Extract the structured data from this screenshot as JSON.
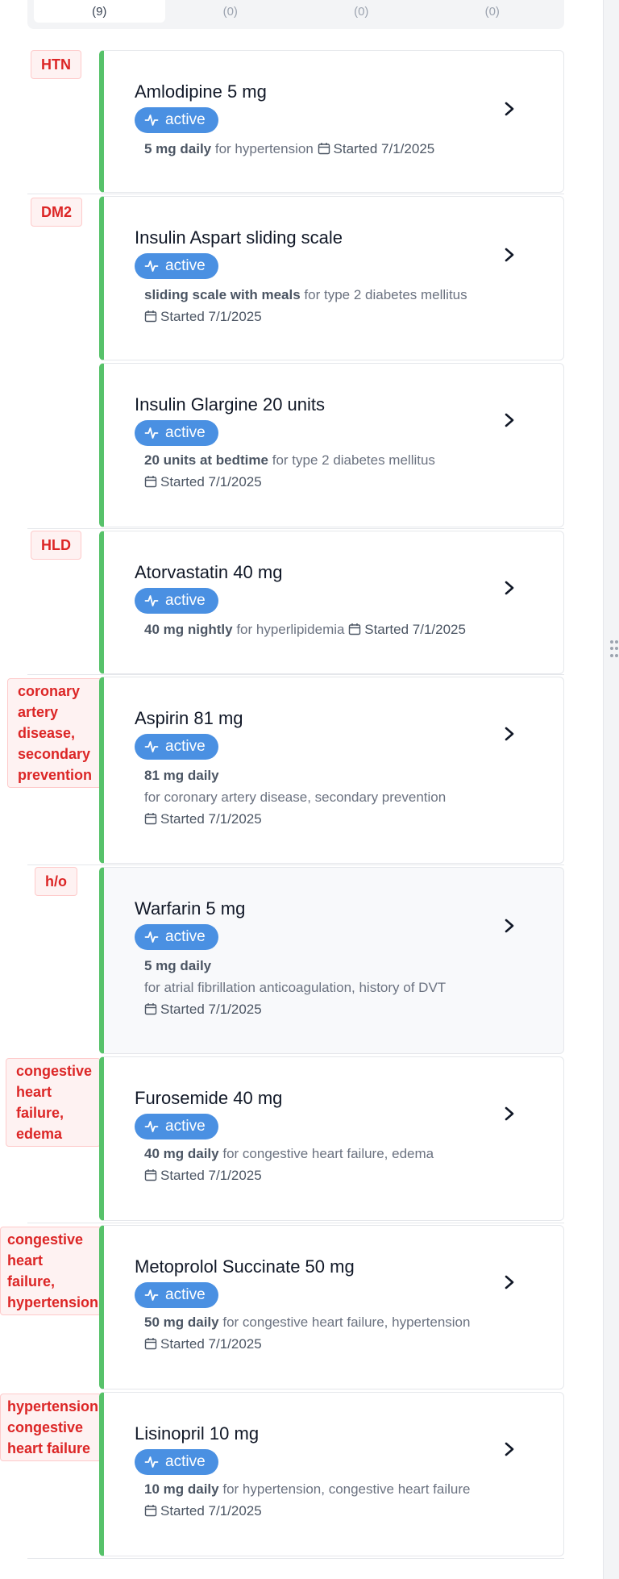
{
  "tabs": [
    {
      "label": "(9)",
      "active": true
    },
    {
      "label": "(0)",
      "active": false
    },
    {
      "label": "(0)",
      "active": false
    },
    {
      "label": "(0)",
      "active": false
    }
  ],
  "status_label": "active",
  "colors": {
    "accent_green": "#57c26a",
    "badge_blue": "#4a90e2",
    "tag_red": "#dc2626"
  },
  "meds": [
    {
      "tag": "HTN",
      "name": "Amlodipine 5 mg",
      "dose": "5 mg daily",
      "indication": "for hypertension",
      "started": "Started 7/1/2025"
    },
    {
      "tag": "DM2",
      "name": "Insulin Aspart sliding scale",
      "dose": "sliding scale with meals",
      "indication": "for type 2 diabetes mellitus",
      "started": "Started 7/1/2025"
    },
    {
      "tag": "",
      "name": "Insulin Glargine 20 units",
      "dose": "20 units at bedtime",
      "indication": "for type 2 diabetes mellitus",
      "started": "Started 7/1/2025"
    },
    {
      "tag": "HLD",
      "name": "Atorvastatin 40 mg",
      "dose": "40 mg nightly",
      "indication": "for hyperlipidemia",
      "started": "Started 7/1/2025"
    },
    {
      "tag": "coronary artery disease, secondary prevention",
      "name": "Aspirin 81 mg",
      "dose": "81 mg daily",
      "indication": "for coronary artery disease, secondary prevention",
      "started": "Started 7/1/2025"
    },
    {
      "tag": "h/o",
      "name": "Warfarin 5 mg",
      "dose": "5 mg daily",
      "indication": "for atrial fibrillation anticoagulation, history of DVT",
      "started": "Started 7/1/2025"
    },
    {
      "tag": "congestive heart failure, edema",
      "name": "Furosemide 40 mg",
      "dose": "40 mg daily",
      "indication": "for congestive heart failure, edema",
      "started": "Started 7/1/2025"
    },
    {
      "tag": "congestive heart failure, hypertension",
      "name": "Metoprolol Succinate 50 mg",
      "dose": "50 mg daily",
      "indication": "for congestive heart failure, hypertension",
      "started": "Started 7/1/2025"
    },
    {
      "tag": "hypertension, congestive heart failure",
      "name": "Lisinopril 10 mg",
      "dose": "10 mg daily",
      "indication": "for hypertension, congestive heart failure",
      "started": "Started 7/1/2025"
    }
  ]
}
